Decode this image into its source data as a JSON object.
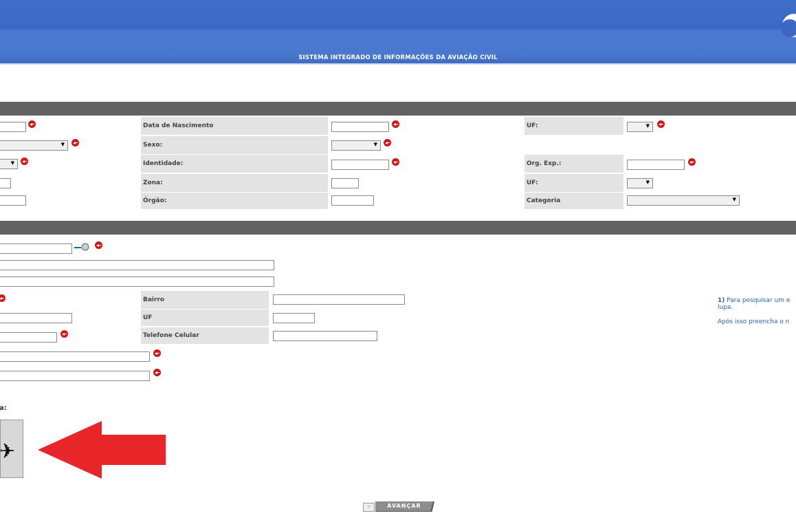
{
  "header": {
    "system_title": "SISTEMA INTEGRADO DE INFORMAÇÕES DA AVIAÇÃO CIVIL"
  },
  "personal": {
    "birth_date_label": "Data de Nascimento",
    "uf_label": "UF:",
    "sex_label": "Sexo:",
    "identity_label": "Identidade:",
    "org_exp_label": "Org. Exp.:",
    "zone_label": "Zona:",
    "uf2_label": "UF:",
    "organ_label": "Órgão:",
    "category_label": "Categoria"
  },
  "address": {
    "neighborhood_label": "Bairro",
    "uf_label": "UF",
    "mobile_label": "Telefone Celular"
  },
  "help": {
    "line1_num": "1)",
    "line1_text": "Para pesquisar um e",
    "line1b": "lupa.",
    "line2": "Após isso preencha o n"
  },
  "captcha": {
    "label_fragment": "a:"
  },
  "actions": {
    "advance_label": "AVANÇAR"
  }
}
